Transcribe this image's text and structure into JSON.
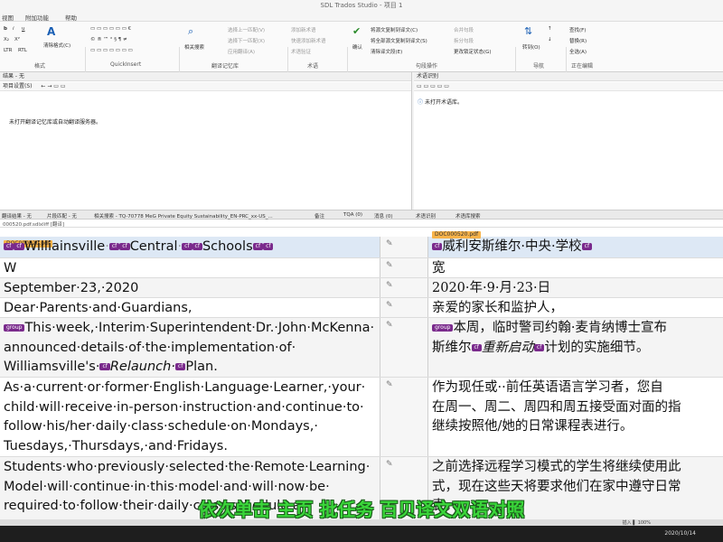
{
  "window": {
    "title": "SDL Trados Studio - 项目 1"
  },
  "menu": {
    "items": [
      "视图",
      "附加功能",
      "帮助"
    ]
  },
  "ribbon": {
    "groups": {
      "format": "格式",
      "quickinsert": "QuickInsert",
      "tm": "翻译记忆库",
      "terms": "术语",
      "actions": "句段操作",
      "nav": "导航",
      "edit": "正在编辑"
    },
    "buttons": {
      "clear_format": "清除格式(C)",
      "concordance": "相关搜索",
      "prev_segment": "选择上一匹配(V)",
      "next_segment": "选择下一匹配(X)",
      "apply_tm": "应用翻译(A)",
      "term_add": "添加新术语",
      "term_quick": "快速添加新术语",
      "term_verify": "术语验证",
      "copy_source": "将源文复制到译文(C)",
      "copy_all": "将全部源文复制到译文(S)",
      "clear_target": "清除译文段(E)",
      "merge": "合并句段",
      "split": "拆分句段",
      "change_lock": "更改锁定状态(G)",
      "confirm": "确认",
      "goto": "转到(O)",
      "find": "查找(F)",
      "replace": "替换(R)",
      "select_all": "全选(A)"
    }
  },
  "tm_panel": {
    "title": "结果 - 无",
    "toolbar_label": "项目设置(S)",
    "message": "未打开翻译记忆库或自动翻译服务器。"
  },
  "term_panel": {
    "title": "术语识别",
    "message": "未打开术语库。"
  },
  "status_strip": {
    "tm_results": "翻译结果 - 无",
    "fragment": "片段匹配 - 无",
    "concordance": "相关搜索 - TQ-70778 MeG Private Equity Sustainability_EN-PRC_xx-US_...",
    "comments": "备注",
    "tqa": "TQA (0)",
    "messages": "消息 (0)",
    "term_recog": "术语识别",
    "termbase_search": "术语库搜索"
  },
  "doc_path": "000520.pdf.sdlxliff [翻译]",
  "segments": [
    {
      "doc": "DOC000520.pdf",
      "source": [
        "{cf}",
        "Williainsville",
        "{cf}",
        "{cf}",
        "Central",
        "{cf}",
        "{cf}",
        "Schools",
        "{cf}",
        "{cf}"
      ],
      "source_text": "Williainsville·Central·Schools",
      "target_doc": "DOC000520.pdf",
      "target": "威利安斯维尔·中央·学校"
    },
    {
      "source_text": "W",
      "target": "宽"
    },
    {
      "source_text": "September·23,·2020",
      "target": "2020·年·9·月·23·日"
    },
    {
      "source_text": "Dear·Parents·and·Guardians,",
      "target": "亲爱的家长和监护人，"
    },
    {
      "source_line1": "This·week,·Interim·Superintendent·Dr.·John·McKenna·",
      "source_line2": "announced·details·of·the·implementation·of·",
      "source_line3a": "Williamsville's·",
      "source_em": "Relaunch·",
      "source_line3b": "Plan.",
      "tag_group": "group",
      "target_line1": "本周，临时警司约翰·麦肯纳博士宣布",
      "target_line2a": "斯维尔",
      "target_em": "重新启动",
      "target_line2b": "计划的实施细节。"
    },
    {
      "source_line1": "As·a·current·or·former·English·Language·Learner,·your·",
      "source_line2": "child·will·receive·in-person·instruction·and·continue·to·",
      "source_line3": "follow·his/her·daily·class·schedule·on·Mondays,·",
      "source_line4": "Tuesdays,·Thursdays,·and·Fridays.",
      "target_line1": "作为现任或··前任英语语言学习者，您自",
      "target_line2": "在周一、周二、周四和周五接受面对面的指",
      "target_line3": "继续按照他/她的日常课程表进行。"
    },
    {
      "source_line1": "Students·who·previously·selected·the·Remote·Learning·",
      "source_line2": "Model·will·continue·in·this·model·and·will·now·be·",
      "source_line3": "required·to·follow·their·daily·class·schedule·at·",
      "target_line1": "之前选择远程学习模式的学生将继续使用此",
      "target_line2": "式，现在这些天将要求他们在家中遵守日常",
      "target_line3": "表。"
    }
  ],
  "subtitle": "依次单击 主页 批任务 百贝译文双语对照",
  "bottom_status": "插入 ▌ 100%",
  "taskbar": {
    "time": "2020/10/14"
  }
}
